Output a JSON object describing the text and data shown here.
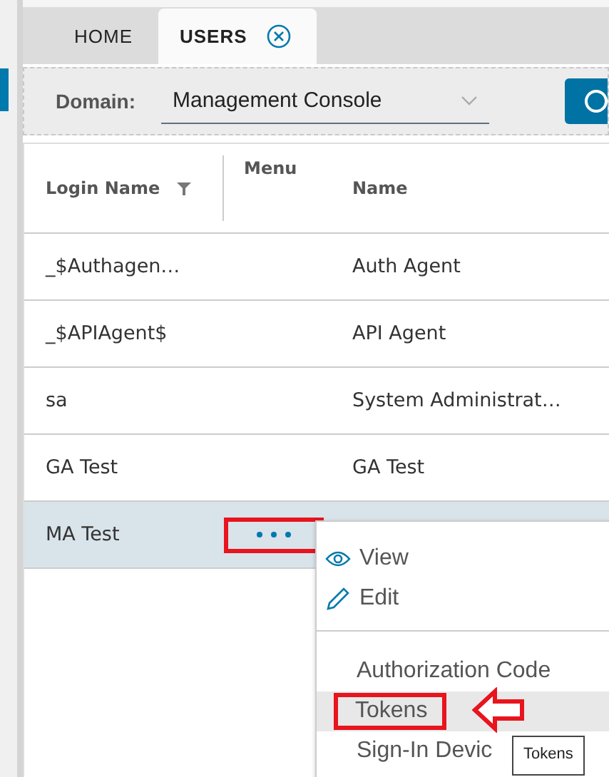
{
  "tabs": [
    {
      "label": "HOME",
      "selected": false,
      "closable": false
    },
    {
      "label": "USERS",
      "selected": true,
      "closable": true
    }
  ],
  "toolbar": {
    "label": "Domain:",
    "domain": "Management Console"
  },
  "table": {
    "columns": [
      "Login Name",
      "Menu",
      "Name"
    ],
    "rows": [
      {
        "login": "_$Authagen…",
        "name": "Auth Agent",
        "selected": false,
        "menu_open": false
      },
      {
        "login": "_$APIAgent$",
        "name": "API Agent",
        "selected": false,
        "menu_open": false
      },
      {
        "login": "sa",
        "name": "System Administrat…",
        "selected": false,
        "menu_open": false
      },
      {
        "login": "GA Test",
        "name": "GA Test",
        "selected": false,
        "menu_open": false
      },
      {
        "login": "MA Test",
        "name": "",
        "selected": true,
        "menu_open": true
      }
    ]
  },
  "context_menu": {
    "items": [
      {
        "label": "View",
        "kind": "icon-view",
        "selected": false
      },
      {
        "label": "Edit",
        "kind": "icon-edit",
        "selected": false
      },
      {
        "kind": "divider"
      },
      {
        "label": "Authorization Code",
        "kind": "plain",
        "selected": false
      },
      {
        "label": "Tokens",
        "kind": "plain",
        "selected": true
      },
      {
        "label": "Sign-In Devic",
        "kind": "plain",
        "selected": false
      }
    ]
  },
  "tooltip": "Tokens"
}
